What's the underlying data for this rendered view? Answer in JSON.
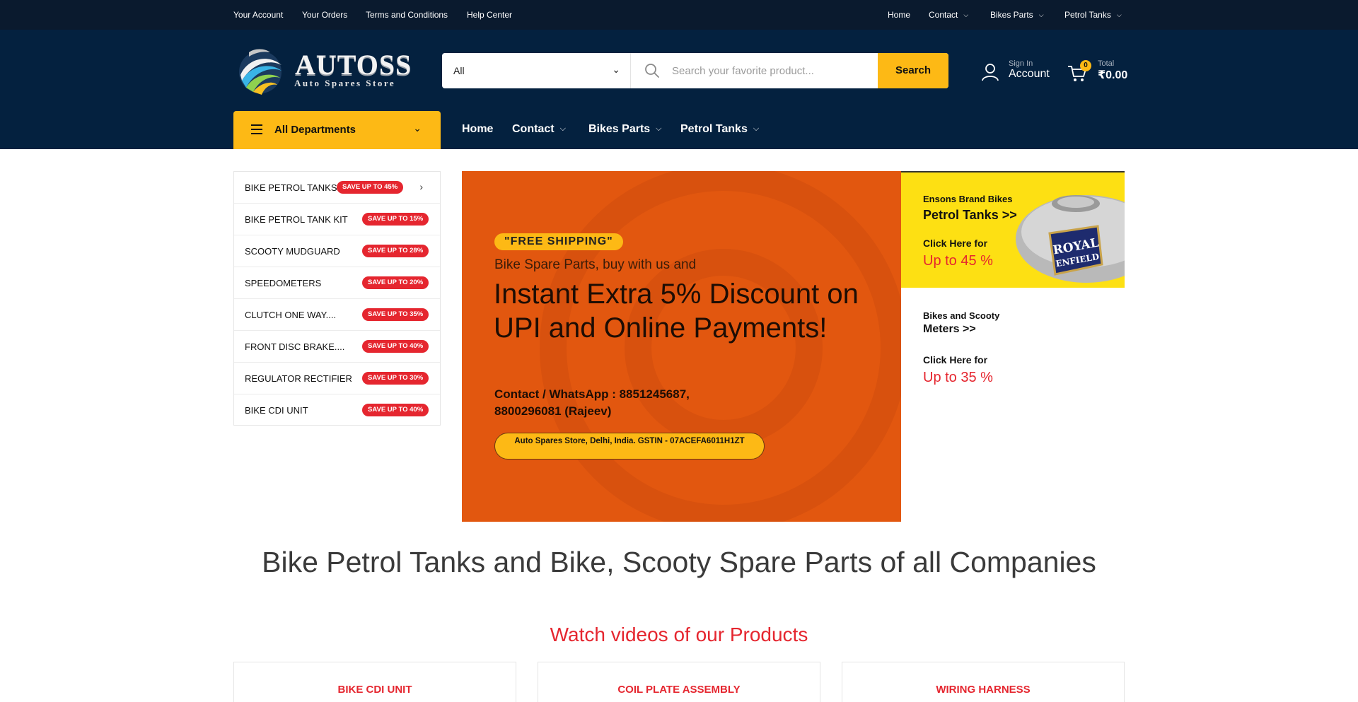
{
  "topbar": {
    "left_links": [
      "Your Account",
      "Your Orders",
      "Terms and Conditions",
      "Help Center"
    ],
    "right_links": [
      {
        "label": "Home",
        "dropdown": false
      },
      {
        "label": "Contact",
        "dropdown": true
      },
      {
        "label": "Bikes Parts",
        "dropdown": true
      },
      {
        "label": "Petrol Tanks",
        "dropdown": true
      }
    ]
  },
  "logo": {
    "title": "AUTOSS",
    "subtitle": "Auto Spares Store"
  },
  "search": {
    "category_value": "All",
    "placeholder": "Search your favorite product...",
    "button_label": "Search"
  },
  "account": {
    "small": "Sign In",
    "big": "Account"
  },
  "cart": {
    "count": "0",
    "small": "Total",
    "big": "₹0.00"
  },
  "departments": {
    "label": "All Departments"
  },
  "main_nav": [
    {
      "label": "Home",
      "dropdown": false
    },
    {
      "label": "Contact",
      "dropdown": true
    },
    {
      "label": "Bikes Parts",
      "dropdown": true
    },
    {
      "label": "Petrol Tanks",
      "dropdown": true
    }
  ],
  "categories": [
    {
      "name": "BIKE PETROL TANKS",
      "badge": "SAVE UP TO 45%",
      "has_arrow": true
    },
    {
      "name": "BIKE PETROL TANK KIT",
      "badge": "SAVE UP TO 15%",
      "has_arrow": false
    },
    {
      "name": "SCOOTY MUDGUARD",
      "badge": "SAVE UP TO 28%",
      "has_arrow": false
    },
    {
      "name": "SPEEDOMETERS",
      "badge": "SAVE UP TO 20%",
      "has_arrow": false
    },
    {
      "name": "CLUTCH ONE WAY....",
      "badge": "SAVE UP TO 35%",
      "has_arrow": false
    },
    {
      "name": "FRONT DISC BRAKE....",
      "badge": "SAVE UP TO 40%",
      "has_arrow": false
    },
    {
      "name": "REGULATOR RECTIFIER",
      "badge": "SAVE UP TO 30%",
      "has_arrow": false
    },
    {
      "name": "BIKE CDI UNIT",
      "badge": "SAVE UP TO 40%",
      "has_arrow": false
    }
  ],
  "hero": {
    "badge": "\"FREE SHIPPING\"",
    "subtitle": "Bike Spare Parts, buy with us and",
    "title": "Instant Extra 5% Discount on UPI and Online Payments!",
    "contact": "Contact / WhatsApp : 8851245687, 8800296081 (Rajeev)",
    "pill": "Auto Spares Store, Delhi, India. GSTIN - 07ACEFA6011H1ZT"
  },
  "promo1": {
    "line1": "Ensons Brand Bikes",
    "line2": "Petrol Tanks >>",
    "line3": "Click Here for",
    "line4": "Up to 45 %",
    "tank_brand": "ROYAL ENFIELD"
  },
  "promo2": {
    "line1": "Bikes and Scooty",
    "line2": "Meters >>",
    "line3": "Click Here for",
    "line4": "Up to 35 %"
  },
  "main_heading": "Bike Petrol Tanks and Bike, Scooty Spare Parts of all Companies",
  "video_heading": "Watch videos of our Products",
  "video_cards": [
    "BIKE CDI UNIT",
    "COIL PLATE ASSEMBLY",
    "WIRING HARNESS"
  ],
  "colors": {
    "topbar_bg": "#0a1a2e",
    "header_bg": "#04213f",
    "accent_yellow": "#fdb915",
    "badge_red": "#e5262f",
    "hero_orange": "#e2570f",
    "promo_yellow": "#fde013"
  }
}
